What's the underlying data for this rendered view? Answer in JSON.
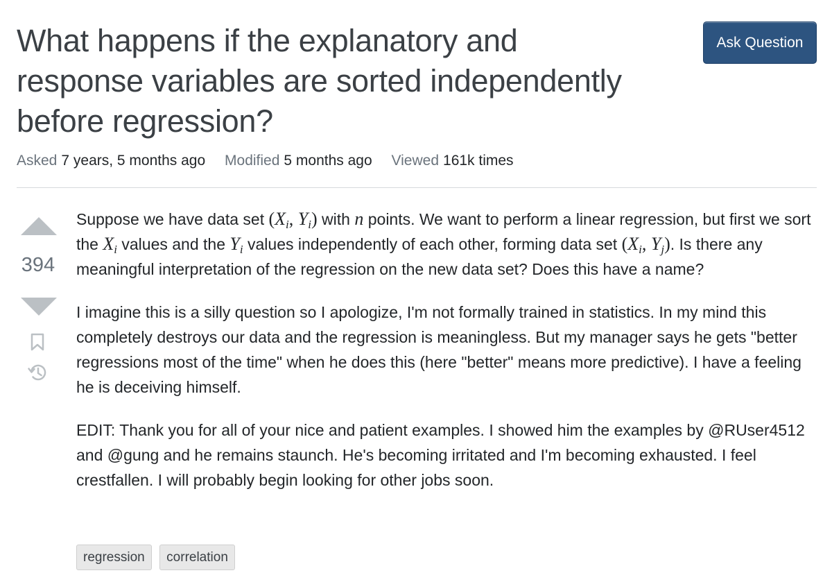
{
  "question": {
    "title": "What happens if the explanatory and response variables are sorted independently before regression?",
    "ask_button_label": "Ask Question",
    "meta": {
      "asked_label": "Asked",
      "asked_value": "7 years, 5 months ago",
      "modified_label": "Modified",
      "modified_value": "5 months ago",
      "viewed_label": "Viewed",
      "viewed_value": "161k times"
    },
    "votes": "394",
    "body": {
      "p1": {
        "t1": "Suppose we have data set ",
        "t2": " with ",
        "t3": " points. We want to perform a linear regression, but first we sort the ",
        "t4": " values and the ",
        "t5": " values independently of each other, forming data set ",
        "t6": ". Is there any meaningful interpretation of the regression on the new data set? Does this have a name?"
      },
      "p2": "I imagine this is a silly question so I apologize, I'm not formally trained in statistics. In my mind this completely destroys our data and the regression is meaningless. But my manager says he gets \"better regressions most of the time\" when he does this (here \"better\" means more predictive). I have a feeling he is deceiving himself.",
      "p3": "EDIT: Thank you for all of your nice and patient examples. I showed him the examples by @RUser4512 and @gung and he remains staunch. He's becoming irritated and I'm becoming exhausted. I feel crestfallen. I will probably begin looking for other jobs soon."
    },
    "math": {
      "paren_open": "(",
      "paren_close": ")",
      "comma": ", ",
      "X": "X",
      "Y": "Y",
      "n": "n",
      "i": "i",
      "j": "j"
    },
    "tags": [
      "regression",
      "correlation"
    ]
  },
  "icons": {
    "upvote": "upvote-arrow-icon",
    "downvote": "downvote-arrow-icon",
    "bookmark": "bookmark-icon",
    "history": "history-icon"
  },
  "colors": {
    "accent_button": "#2d5480",
    "vote_arrow": "#bbc0c4",
    "muted_text": "#6a737c"
  }
}
